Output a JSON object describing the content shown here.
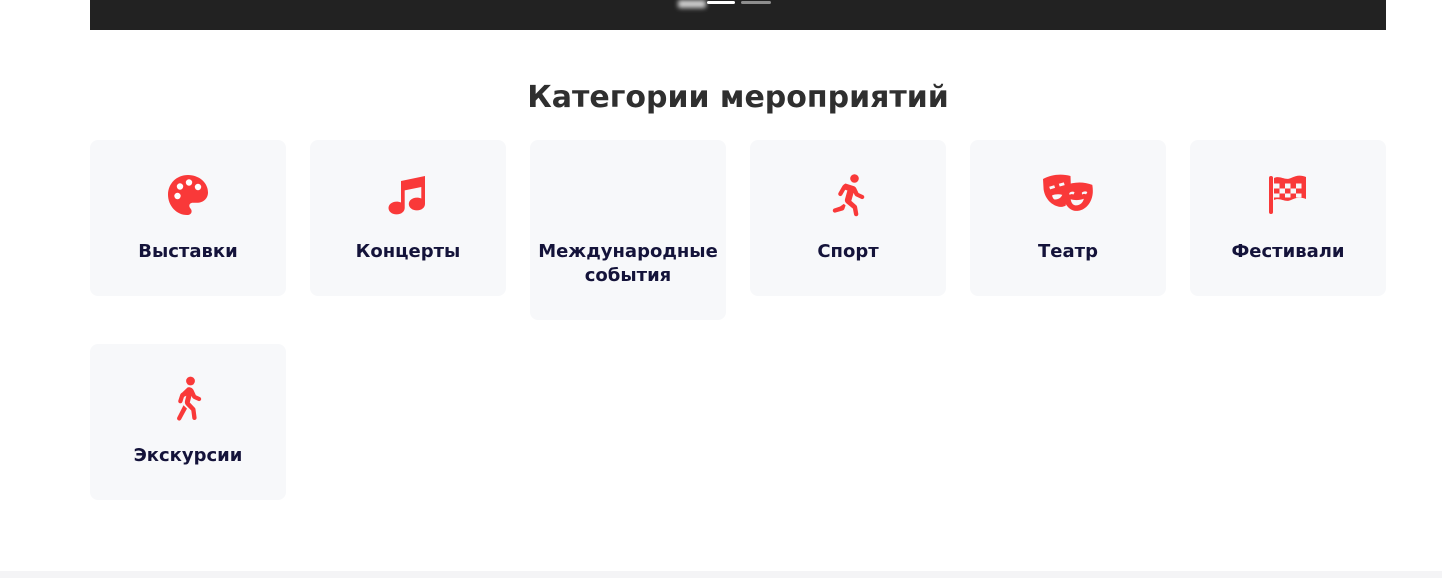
{
  "section": {
    "title": "Категории мероприятий"
  },
  "categories": [
    {
      "label": "Выставки",
      "icon": "palette-icon"
    },
    {
      "label": "Концерты",
      "icon": "music-note-icon"
    },
    {
      "label": "Международные события",
      "icon": "none"
    },
    {
      "label": "Спорт",
      "icon": "running-person-icon"
    },
    {
      "label": "Театр",
      "icon": "theater-masks-icon"
    },
    {
      "label": "Фестивали",
      "icon": "checkered-flag-icon"
    },
    {
      "label": "Экскурсии",
      "icon": "walking-person-icon"
    }
  ],
  "colors": {
    "accent": "#f93939",
    "card_bg": "#f7f8fa",
    "title_text": "#2f2f2f",
    "label_text": "#14133a"
  }
}
